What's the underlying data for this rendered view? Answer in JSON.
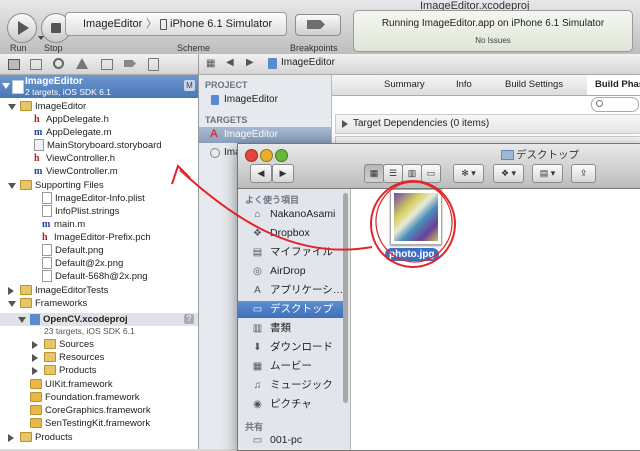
{
  "window": {
    "title": "ImageEditor.xcodeproj"
  },
  "toolbar": {
    "run_label": "Run",
    "stop_label": "Stop",
    "scheme_project": "ImageEditor",
    "scheme_sep": "〉",
    "scheme_destination": "iPhone 6.1 Simulator",
    "scheme_label": "Scheme",
    "breakpoints_label": "Breakpoints",
    "activity_status": "Running ImageEditor.app on iPhone 6.1 Simulator",
    "activity_issues": "No Issues"
  },
  "navigator": {
    "root_name": "ImageEditor",
    "root_sub": "2 targets, iOS SDK 6.1",
    "root_badge": "M",
    "items": [
      {
        "label": "ImageEditor",
        "icon": "folder"
      },
      {
        "label": "AppDelegate.h",
        "icon": "h-file"
      },
      {
        "label": "AppDelegate.m",
        "icon": "m-file"
      },
      {
        "label": "MainStoryboard.storyboard",
        "icon": "storyboard"
      },
      {
        "label": "ViewController.h",
        "icon": "h-file"
      },
      {
        "label": "ViewController.m",
        "icon": "m-file"
      },
      {
        "label": "Supporting Files",
        "icon": "folder"
      },
      {
        "label": "ImageEditor-Info.plist",
        "icon": "doc"
      },
      {
        "label": "InfoPlist.strings",
        "icon": "doc"
      },
      {
        "label": "main.m",
        "icon": "m-file"
      },
      {
        "label": "ImageEditor-Prefix.pch",
        "icon": "h-file"
      },
      {
        "label": "Default.png",
        "icon": "doc"
      },
      {
        "label": "Default@2x.png",
        "icon": "doc"
      },
      {
        "label": "Default-568h@2x.png",
        "icon": "doc"
      },
      {
        "label": "ImageEditorTests",
        "icon": "folder"
      },
      {
        "label": "Frameworks",
        "icon": "folder"
      },
      {
        "label": "OpenCV.xcodeproj",
        "icon": "project"
      },
      {
        "label": "23 targets, iOS SDK 6.1",
        "icon": ""
      },
      {
        "label": "Sources",
        "icon": "folder"
      },
      {
        "label": "Resources",
        "icon": "folder"
      },
      {
        "label": "Products",
        "icon": "folder"
      },
      {
        "label": "UIKit.framework",
        "icon": "framework"
      },
      {
        "label": "Foundation.framework",
        "icon": "framework"
      },
      {
        "label": "CoreGraphics.framework",
        "icon": "framework"
      },
      {
        "label": "SenTestingKit.framework",
        "icon": "framework"
      },
      {
        "label": "Products",
        "icon": "folder"
      }
    ],
    "opencv_badge": "?"
  },
  "editor": {
    "jump_item": "ImageEditor",
    "project_header": "PROJECT",
    "project_item": "ImageEditor",
    "targets_header": "TARGETS",
    "target_item": "ImageEditor",
    "target_item2": "Ima",
    "tabs": [
      "Summary",
      "Info",
      "Build Settings",
      "Build Phas"
    ],
    "search_placeholder": "",
    "phase1": "Target Dependencies (0 items)"
  },
  "finder": {
    "title": "デスクトップ",
    "favorites_header": "よく使う項目",
    "favorites": [
      {
        "label": "NakanoAsami",
        "icon": "home-icon"
      },
      {
        "label": "Dropbox",
        "icon": "dropbox-icon"
      },
      {
        "label": "マイファイル",
        "icon": "all-files-icon"
      },
      {
        "label": "AirDrop",
        "icon": "airdrop-icon"
      },
      {
        "label": "アプリケーシ…",
        "icon": "applications-icon"
      },
      {
        "label": "デスクトップ",
        "icon": "desktop-icon"
      },
      {
        "label": "書類",
        "icon": "documents-icon"
      },
      {
        "label": "ダウンロード",
        "icon": "downloads-icon"
      },
      {
        "label": "ムービー",
        "icon": "movies-icon"
      },
      {
        "label": "ミュージック",
        "icon": "music-icon"
      },
      {
        "label": "ピクチャ",
        "icon": "pictures-icon"
      }
    ],
    "shared_header": "共有",
    "shared": [
      {
        "label": "001-pc",
        "icon": "computer-icon"
      }
    ],
    "file_name": "photo.jpg",
    "colors": {
      "selection": "#3f6fb8",
      "annotation": "#e0262a"
    }
  }
}
